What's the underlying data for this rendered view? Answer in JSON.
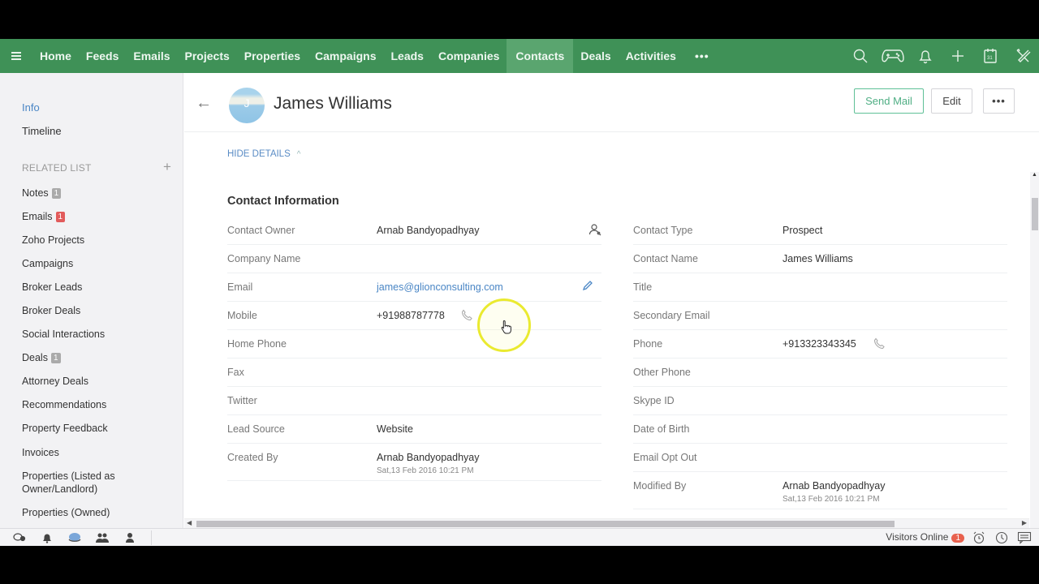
{
  "nav": {
    "items": [
      "Home",
      "Feeds",
      "Emails",
      "Projects",
      "Properties",
      "Campaigns",
      "Leads",
      "Companies",
      "Contacts",
      "Deals",
      "Activities"
    ],
    "active": "Contacts",
    "more": "•••",
    "icons": [
      "search-icon",
      "game-controller-icon",
      "bell-icon",
      "plus-icon",
      "calendar-icon",
      "tools-icon"
    ],
    "calendar_day": "31",
    "bg_color": "#3f9157",
    "active_bg_color": "#5aa56f"
  },
  "sidebar": {
    "info": "Info",
    "timeline": "Timeline",
    "related_header": "RELATED LIST",
    "add": "+",
    "items": [
      {
        "label": "Notes",
        "badge": "1",
        "badge_color": "gray"
      },
      {
        "label": "Emails",
        "badge": "1",
        "badge_color": "red"
      },
      {
        "label": "Zoho Projects"
      },
      {
        "label": "Campaigns"
      },
      {
        "label": "Broker Leads"
      },
      {
        "label": "Broker Deals"
      },
      {
        "label": "Social Interactions"
      },
      {
        "label": "Deals",
        "badge": "1",
        "badge_color": "gray"
      },
      {
        "label": "Attorney Deals"
      },
      {
        "label": "Recommendations"
      },
      {
        "label": "Property Feedback"
      },
      {
        "label": "Invoices"
      },
      {
        "label": "Properties (Listed as Owner/Landlord)"
      },
      {
        "label": "Properties (Owned)"
      }
    ]
  },
  "header": {
    "back": "←",
    "avatar_initial": "J",
    "title": "James Williams",
    "send_mail": "Send Mail",
    "edit": "Edit",
    "more": "•••"
  },
  "details": {
    "toggle": "HIDE DETAILS",
    "toggle_chevron": "^",
    "section_title": "Contact Information",
    "left": [
      {
        "label": "Contact Owner",
        "value": "Arnab Bandyopadhyay",
        "icon": "user-lookup-icon"
      },
      {
        "label": "Company Name",
        "value": ""
      },
      {
        "label": "Email",
        "value": "james@glionconsulting.com",
        "link": true,
        "icon": "pencil-icon"
      },
      {
        "label": "Mobile",
        "value": "+91988787778",
        "icon": "phone-icon"
      },
      {
        "label": "Home Phone",
        "value": ""
      },
      {
        "label": "Fax",
        "value": ""
      },
      {
        "label": "Twitter",
        "value": ""
      },
      {
        "label": "Lead Source",
        "value": "Website"
      },
      {
        "label": "Created By",
        "value": "Arnab Bandyopadhyay",
        "sub": "Sat,13 Feb 2016 10:21 PM"
      }
    ],
    "right": [
      {
        "label": "Contact Type",
        "value": "Prospect"
      },
      {
        "label": "Contact Name",
        "value": "James Williams"
      },
      {
        "label": "Title",
        "value": ""
      },
      {
        "label": "Secondary Email",
        "value": ""
      },
      {
        "label": "Phone",
        "value": "+913323343345",
        "icon": "phone-icon"
      },
      {
        "label": "Other Phone",
        "value": ""
      },
      {
        "label": "Skype ID",
        "value": ""
      },
      {
        "label": "Date of Birth",
        "value": ""
      },
      {
        "label": "Email Opt Out",
        "value": ""
      },
      {
        "label": "Modified By",
        "value": "Arnab Bandyopadhyay",
        "sub": "Sat,13 Feb 2016 10:21 PM"
      }
    ]
  },
  "bottombar": {
    "visitors_label": "Visitors Online",
    "visitors_count": "1"
  }
}
